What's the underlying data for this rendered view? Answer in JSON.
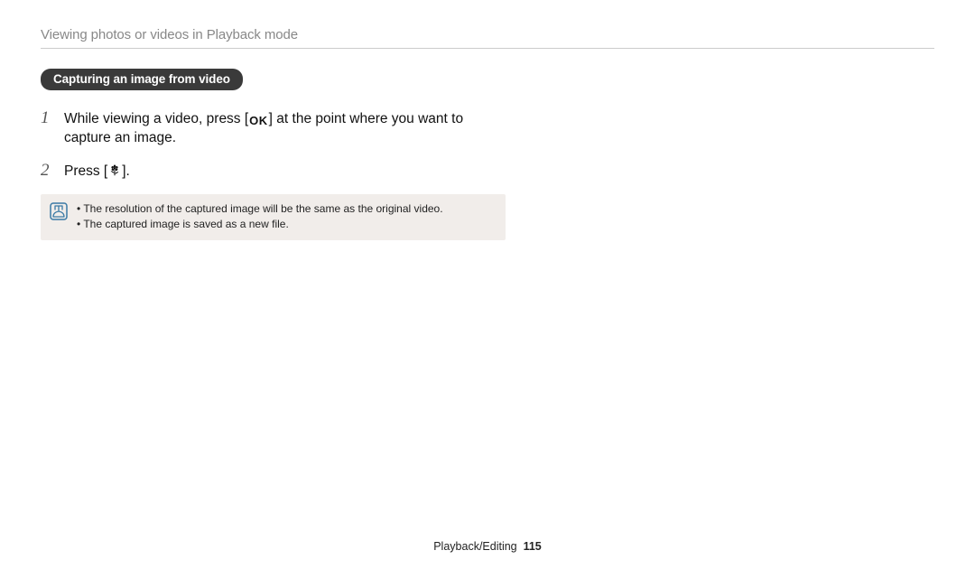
{
  "header": {
    "title": "Viewing photos or videos in Playback mode"
  },
  "section": {
    "pill_label": "Capturing an image from video"
  },
  "steps": [
    {
      "num": "1",
      "text_before": "While viewing a video, press [",
      "icon_label": "OK",
      "text_after": "] at the point where you want to capture an image."
    },
    {
      "num": "2",
      "text_before": "Press [",
      "icon_label": "macro-icon",
      "text_after": "]."
    }
  ],
  "notes": [
    "The resolution of the captured image will be the same as the original video.",
    "The captured image is saved as a new file."
  ],
  "footer": {
    "section": "Playback/Editing",
    "page": "115"
  }
}
